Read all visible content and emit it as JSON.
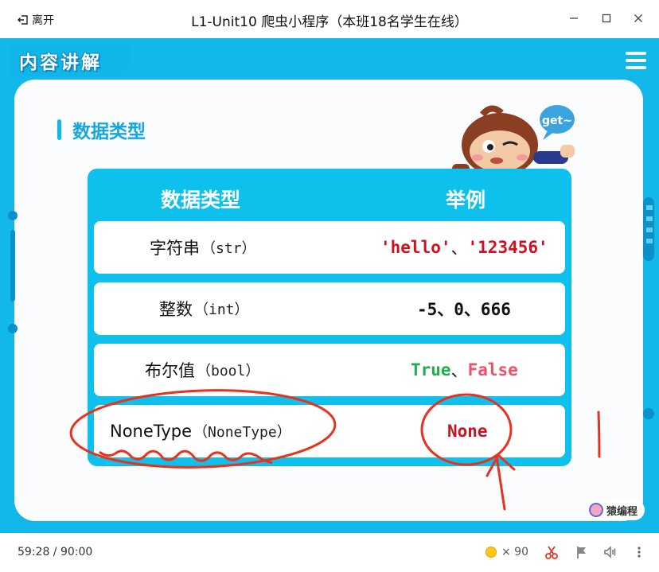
{
  "window": {
    "leave_label": "离开",
    "title": "L1-Unit10 爬虫小程序（本班18名学生在线）"
  },
  "slide": {
    "header_title": "内容讲解",
    "section_title": "数据类型",
    "bubble_text": "get~",
    "brand_label": "猿编程",
    "table": {
      "col_type": "数据类型",
      "col_example": "举例",
      "rows": [
        {
          "type": "字符串",
          "paren": "（str）"
        },
        {
          "type": "整数",
          "paren": "（int）"
        },
        {
          "type": "布尔值",
          "paren": "（bool）"
        },
        {
          "type": "NoneType",
          "paren": "（NoneType）"
        }
      ],
      "examples": {
        "str_a": "'hello'",
        "str_sep": "、",
        "str_b": "'123456'",
        "int_text": "-5、0、666",
        "bool_true": "True",
        "bool_sep": "、",
        "bool_false": "False",
        "none": "None"
      }
    }
  },
  "bottombar": {
    "time": "59:28 / 90:00",
    "coin_count": "× 90"
  },
  "colors": {
    "accent": "#12b8ea",
    "red": "#d20f1e",
    "green": "#1fae4a",
    "pink": "#f05068",
    "annotation": "#e8321e"
  },
  "icons": [
    "leave-icon",
    "minimize-icon",
    "maximize-icon",
    "close-icon",
    "menu-icon",
    "coin-icon",
    "scissors-icon",
    "flag-icon",
    "volume-icon",
    "more-icon"
  ]
}
